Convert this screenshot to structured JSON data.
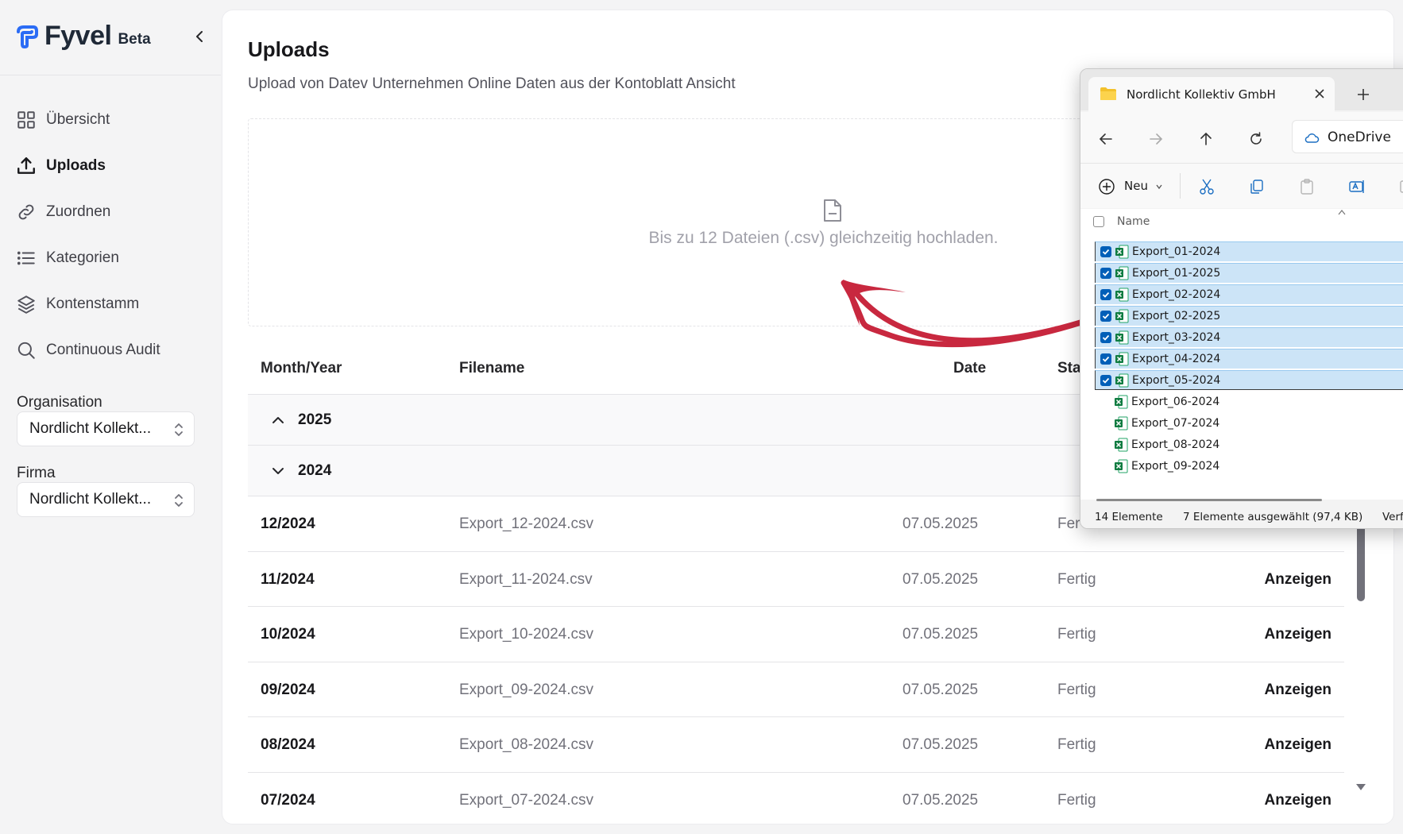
{
  "app": {
    "name": "Fyvel",
    "badge": "Beta"
  },
  "sidebar": {
    "items": [
      {
        "label": "Übersicht",
        "icon": "grid-icon",
        "active": false
      },
      {
        "label": "Uploads",
        "icon": "upload-icon",
        "active": true
      },
      {
        "label": "Zuordnen",
        "icon": "link-icon",
        "active": false
      },
      {
        "label": "Kategorien",
        "icon": "list-icon",
        "active": false
      },
      {
        "label": "Kontenstamm",
        "icon": "layers-icon",
        "active": false
      },
      {
        "label": "Continuous Audit",
        "icon": "search-icon",
        "active": false
      }
    ],
    "organisation_label": "Organisation",
    "organisation_value": "Nordlicht Kollekt...",
    "firma_label": "Firma",
    "firma_value": "Nordlicht Kollekt..."
  },
  "main": {
    "title": "Uploads",
    "subtitle": "Upload von Datev Unternehmen Online Daten aus der Kontoblatt Ansicht",
    "dropzone_text": "Bis zu 12 Dateien (.csv) gleichzeitig hochladen.",
    "columns": {
      "month": "Month/Year",
      "file": "Filename",
      "date": "Date",
      "status": "Sta"
    },
    "groups": [
      {
        "year": "2025",
        "expanded": false
      },
      {
        "year": "2024",
        "expanded": true
      }
    ],
    "rows": [
      {
        "month": "12/2024",
        "file": "Export_12-2024.csv",
        "date": "07.05.2025",
        "status": "Fer",
        "action": ""
      },
      {
        "month": "11/2024",
        "file": "Export_11-2024.csv",
        "date": "07.05.2025",
        "status": "Fertig",
        "action": "Anzeigen"
      },
      {
        "month": "10/2024",
        "file": "Export_10-2024.csv",
        "date": "07.05.2025",
        "status": "Fertig",
        "action": "Anzeigen"
      },
      {
        "month": "09/2024",
        "file": "Export_09-2024.csv",
        "date": "07.05.2025",
        "status": "Fertig",
        "action": "Anzeigen"
      },
      {
        "month": "08/2024",
        "file": "Export_08-2024.csv",
        "date": "07.05.2025",
        "status": "Fertig",
        "action": "Anzeigen"
      },
      {
        "month": "07/2024",
        "file": "Export_07-2024.csv",
        "date": "07.05.2025",
        "status": "Fertig",
        "action": "Anzeigen"
      }
    ]
  },
  "explorer": {
    "tab_title": "Nordlicht Kollektiv GmbH",
    "address": "OneDrive",
    "new_label": "Neu",
    "column_name": "Name",
    "files": [
      {
        "name": "Export_01-2024",
        "selected": true
      },
      {
        "name": "Export_01-2025",
        "selected": true
      },
      {
        "name": "Export_02-2024",
        "selected": true
      },
      {
        "name": "Export_02-2025",
        "selected": true
      },
      {
        "name": "Export_03-2024",
        "selected": true
      },
      {
        "name": "Export_04-2024",
        "selected": true
      },
      {
        "name": "Export_05-2024",
        "selected": true
      },
      {
        "name": "Export_06-2024",
        "selected": false
      },
      {
        "name": "Export_07-2024",
        "selected": false
      },
      {
        "name": "Export_08-2024",
        "selected": false
      },
      {
        "name": "Export_09-2024",
        "selected": false
      }
    ],
    "status_count": "14 Elemente",
    "status_selected": "7 Elemente ausgewählt (97,4 KB)",
    "status_extra": "Verf"
  },
  "colors": {
    "accent": "#2b6cf5",
    "arrow": "#c8283f",
    "selection": "#cce4f7"
  }
}
